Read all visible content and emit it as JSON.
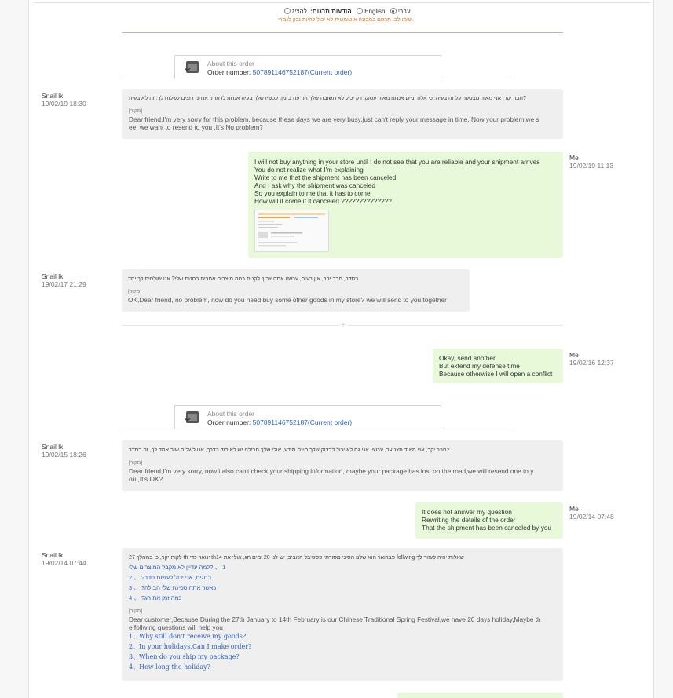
{
  "lang_bar": {
    "options": [
      {
        "label": "עברי",
        "selected": true
      },
      {
        "label": "English",
        "selected": false
      },
      {
        "label": "הודעות תרגום:",
        "selected": false
      },
      {
        "label": "להציג",
        "selected": false
      }
    ],
    "note": ".שימו לב: תרגום במכונה אוטומטית לא יכול להיות נכון לגמרי"
  },
  "order_cards": [
    {
      "title": "About this order",
      "number_label": "Order number: ",
      "number_link": "507891146752187(Current order)"
    },
    {
      "title": "About this order",
      "number_label": "Order number: ",
      "number_link": "507891146752187(Current order)"
    }
  ],
  "messages": [
    {
      "sender": "Snail lk",
      "time": "19/02/19 18:30",
      "direction": "in",
      "original": "?חבר יקר, אני מאוד מצטער על זה בעיה, כי אלה ימים אנחנו מאוד עסוק, רק יכול לא תשובה שלך הודעה בזמן, עכשיו שלך בעיה אנחנו לראות, אנחנו רוצים לשלוח לך, זה לא בעיה",
      "orig_tag": "[מקור]",
      "translation": [
        "Dear friend,I'm very sorry for this problem, because these days we are very busy,just can't reply your message in time, Now your problem we s",
        "ee, we want to resend to you ,It's No problem?"
      ]
    },
    {
      "sender": "Me",
      "time": "19/02/19 11:13",
      "direction": "out",
      "lines": [
        "I will not buy anything in your store until I do not see that you are reliable and your shipment arrives",
        "You do not realize what I'm explaining",
        "Write to me that the shipment has been canceled",
        "And I ask why the shipment was canceled",
        "So you explain to me that it has to come",
        "How will it come if it canceled ??????????????"
      ]
    },
    {
      "sender": "Snail lk",
      "time": "19/02/17 21:29",
      "direction": "in",
      "original": "בסדר, חבר יקר, אין בעיה, עכשיו אתה צריך לקנות כמה מוצרים אחרים בחנות שלי? אנו שולחים לך יחד",
      "orig_tag": "[מקור]",
      "translation": [
        "OK,Dear friend, no problem, now do you need buy some other goods in my store? we will send to you together"
      ]
    },
    {
      "sender": "Me",
      "time": "19/02/16 12:37",
      "direction": "out",
      "lines": [
        "Okay, send another",
        "But extend my defense time",
        "Because otherwise I will open a conflict"
      ]
    },
    {
      "sender": "Snail lk",
      "time": "19/02/15 18:26",
      "direction": "in",
      "original": "?חבר יקר, אני מאוד מצטער, עכשיו אני גם לא יכול לבדוק שלך חינם מידע, אולי שלך חבילה יש לאיבוד בדרך, אנו לשלוח שוב אחד לך, זה בסדר",
      "orig_tag": "[מקור]",
      "translation": [
        "Dear friend,I'm very sorry, now i also can't check your shipping information, maybe your package has lost on the road,we will resend one to y",
        "ou ,It's OK?"
      ]
    },
    {
      "sender": "Me",
      "time": "19/02/14 07:48",
      "direction": "out",
      "lines": [
        "It does not answer my question",
        "Rewriting the details of the order",
        "That the shipment has been canceled by you"
      ]
    },
    {
      "sender": "Snail lk",
      "time": "19/02/14 07:44",
      "direction": "in",
      "original": "שאלות יהיה לעזור לך follwing פברואר הוא שלנו הסיני מסורתי פסטיבל האביב, יש לנו 20 ימים חג, אולי את th14 ינואר כדי th לקוח יקר, כי במהלך 27",
      "orig_questions": [
        "1 、 ?למה עדיין לא מקבל המוצרים שלי",
        "2 、 ?בחגים, אני יכול לעשות סדר",
        "3 、 ?כאשר אתה ספינה שלי חבילה",
        "4 、 ?כמה זמן את חג"
      ],
      "orig_tag": "[מקור]",
      "translation": [
        "Dear customer,Because During the 27th January to 14th February is our Chinese Traditional Spring Festival,we have 20 days holiday,Maybe th",
        "e follwing questions will help you"
      ],
      "questions": [
        "1、Why still don't receive my goods?",
        "2、In your holidays,Can I make order?",
        "3、When do you ship my package?",
        "4、How long the holiday?"
      ]
    }
  ],
  "colors": {
    "incoming_bg": "#efefef",
    "outgoing_bg": "#e8f9da",
    "link": "#2b62c4",
    "note": "#e07b20"
  }
}
